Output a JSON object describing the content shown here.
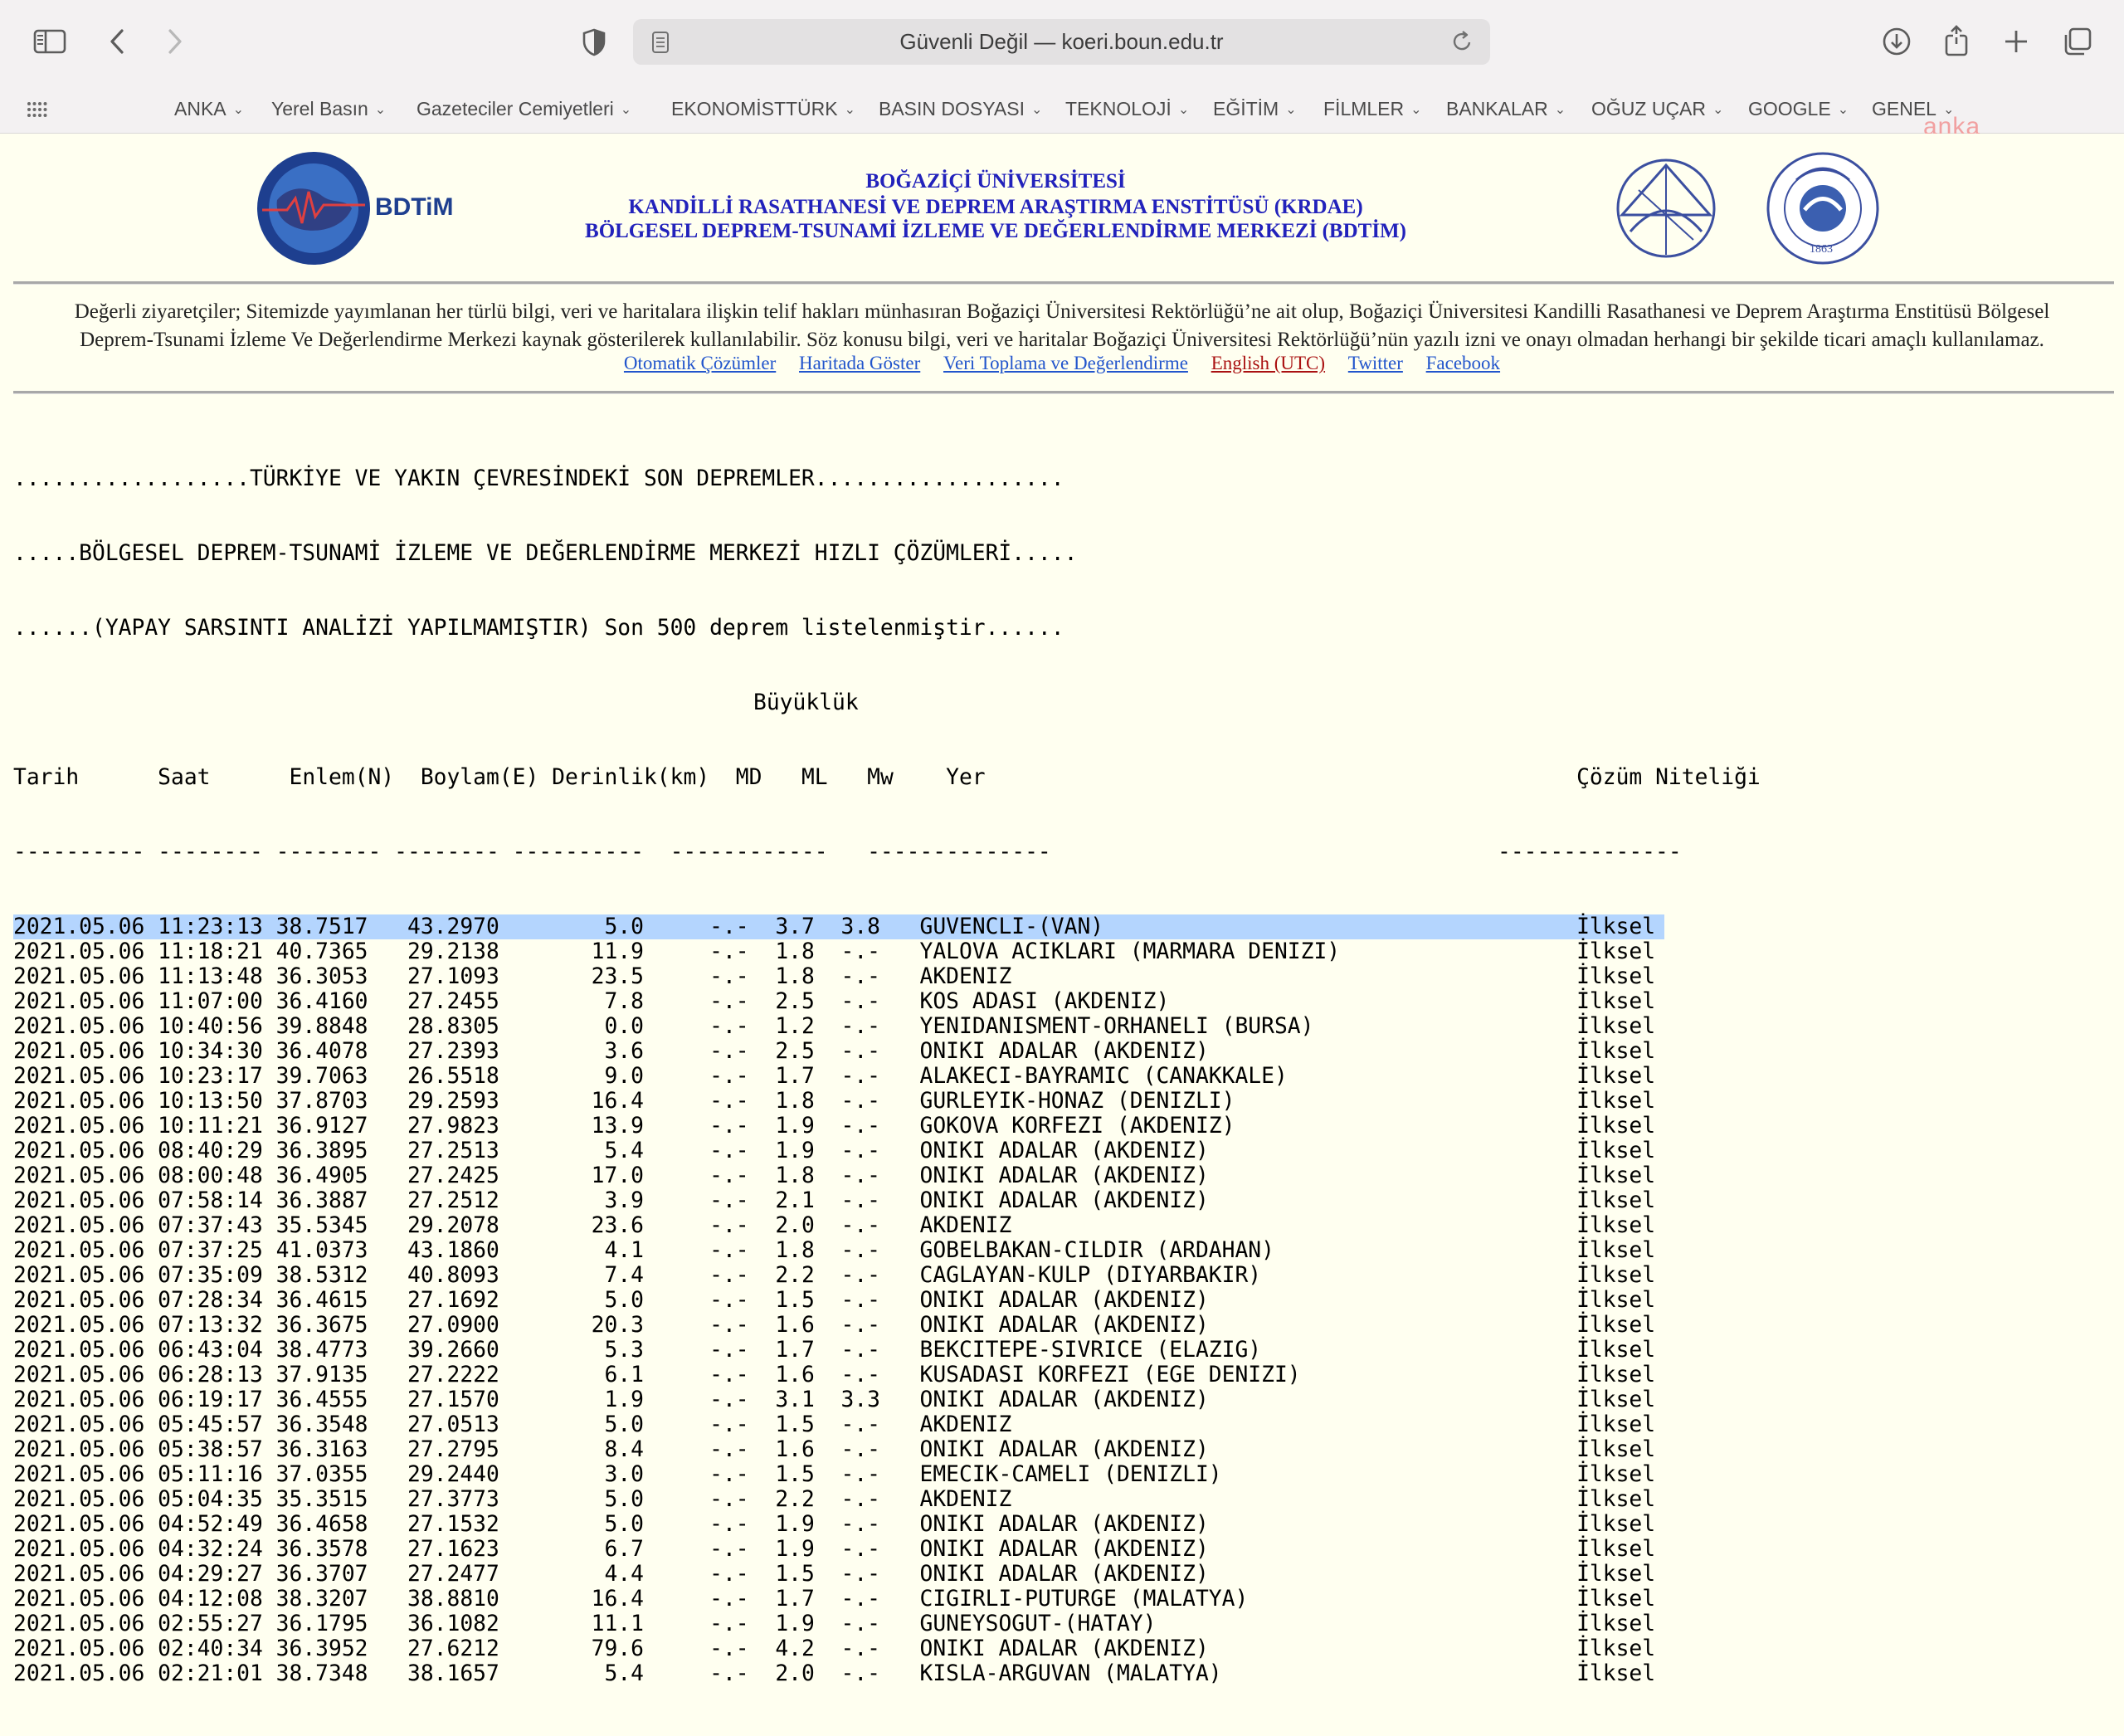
{
  "browser": {
    "url_text": "Güvenli Değil — koeri.boun.edu.tr",
    "bookmarks": [
      {
        "label": "ANKA"
      },
      {
        "label": "Yerel Basın"
      },
      {
        "label": "Gazeteciler Cemiyetleri"
      },
      {
        "label": "EKONOMİSTTÜRK"
      },
      {
        "label": "BASIN DOSYASI"
      },
      {
        "label": "TEKNOLOJİ"
      },
      {
        "label": "EĞİTİM"
      },
      {
        "label": "FİLMLER"
      },
      {
        "label": "BANKALAR"
      },
      {
        "label": "OĞUZ UÇAR"
      },
      {
        "label": "GOOGLE"
      },
      {
        "label": "GENEL"
      }
    ]
  },
  "watermark": "anka",
  "header": {
    "logo_text": "BDTiM",
    "line1": "BOĞAZİÇİ ÜNİVERSİTESİ",
    "line2": "KANDİLLİ RASATHANESİ VE DEPREM ARAŞTIRMA ENSTİTÜSÜ (KRDAE)",
    "line3": "BÖLGESEL DEPREM-TSUNAMİ İZLEME VE DEĞERLENDİRME MERKEZİ (BDTİM)",
    "seal_year": "1863"
  },
  "notice": {
    "line1": "Değerli ziyaretçiler; Sitemizde yayımlanan her türlü bilgi, veri ve haritalara ilişkin telif hakları münhasıran Boğaziçi Üniversitesi Rektörlüğü’ne ait olup, Boğaziçi Üniversitesi Kandilli Rasathanesi ve Deprem Araştırma Enstitüsü Bölgesel",
    "line2": "Deprem-Tsunami İzleme Ve Değerlendirme Merkezi kaynak gösterilerek kullanılabilir. Söz konusu bilgi, veri ve haritalar Boğaziçi Üniversitesi Rektörlüğü’nün yazılı izni ve onayı olmadan herhangi bir şekilde ticari amaçlı kullanılamaz."
  },
  "links": {
    "auto": "Otomatik Çözümler",
    "map": "Haritada Göster",
    "data": "Veri Toplama ve Değerlendirme",
    "english": "English (UTC)",
    "twitter": "Twitter",
    "facebook": "Facebook"
  },
  "listing": {
    "title1": "..................TÜRKİYE VE YAKIN ÇEVRESİNDEKİ SON DEPREMLER...................",
    "title2": ".....BÖLGESEL DEPREM-TSUNAMİ İZLEME VE DEĞERLENDİRME MERKEZİ HIZLI ÇÖZÜMLERİ.....",
    "title3": "......(YAPAY SARSINTI ANALİZİ YAPILMAMIŞTIR) Son 500 deprem listelenmiştir......",
    "magnitude_header": "Büyüklük",
    "columns": {
      "date": "Tarih",
      "time": "Saat",
      "lat": "Enlem(N)",
      "lon": "Boylam(E)",
      "depth": "Derinlik(km)",
      "md": "MD",
      "ml": "ML",
      "mw": "Mw",
      "place": "Yer",
      "quality": "Çözüm Niteliği"
    },
    "rows": [
      [
        "2021.05.06",
        "11:23:13",
        "38.7517",
        "43.2970",
        "5.0",
        "-.-",
        "3.7",
        "3.8",
        "GUVENCLI-(VAN)",
        "İlksel"
      ],
      [
        "2021.05.06",
        "11:18:21",
        "40.7365",
        "29.2138",
        "11.9",
        "-.-",
        "1.8",
        "-.-",
        "YALOVA ACIKLARI (MARMARA DENIZI)",
        "İlksel"
      ],
      [
        "2021.05.06",
        "11:13:48",
        "36.3053",
        "27.1093",
        "23.5",
        "-.-",
        "1.8",
        "-.-",
        "AKDENIZ",
        "İlksel"
      ],
      [
        "2021.05.06",
        "11:07:00",
        "36.4160",
        "27.2455",
        "7.8",
        "-.-",
        "2.5",
        "-.-",
        "KOS ADASI (AKDENIZ)",
        "İlksel"
      ],
      [
        "2021.05.06",
        "10:40:56",
        "39.8848",
        "28.8305",
        "0.0",
        "-.-",
        "1.2",
        "-.-",
        "YENIDANISMENT-ORHANELI (BURSA)",
        "İlksel"
      ],
      [
        "2021.05.06",
        "10:34:30",
        "36.4078",
        "27.2393",
        "3.6",
        "-.-",
        "2.5",
        "-.-",
        "ONIKI ADALAR (AKDENIZ)",
        "İlksel"
      ],
      [
        "2021.05.06",
        "10:23:17",
        "39.7063",
        "26.5518",
        "9.0",
        "-.-",
        "1.7",
        "-.-",
        "ALAKECI-BAYRAMIC (CANAKKALE)",
        "İlksel"
      ],
      [
        "2021.05.06",
        "10:13:50",
        "37.8703",
        "29.2593",
        "16.4",
        "-.-",
        "1.8",
        "-.-",
        "GURLEYIK-HONAZ (DENIZLI)",
        "İlksel"
      ],
      [
        "2021.05.06",
        "10:11:21",
        "36.9127",
        "27.9823",
        "13.9",
        "-.-",
        "1.9",
        "-.-",
        "GOKOVA KORFEZI (AKDENIZ)",
        "İlksel"
      ],
      [
        "2021.05.06",
        "08:40:29",
        "36.3895",
        "27.2513",
        "5.4",
        "-.-",
        "1.9",
        "-.-",
        "ONIKI ADALAR (AKDENIZ)",
        "İlksel"
      ],
      [
        "2021.05.06",
        "08:00:48",
        "36.4905",
        "27.2425",
        "17.0",
        "-.-",
        "1.8",
        "-.-",
        "ONIKI ADALAR (AKDENIZ)",
        "İlksel"
      ],
      [
        "2021.05.06",
        "07:58:14",
        "36.3887",
        "27.2512",
        "3.9",
        "-.-",
        "2.1",
        "-.-",
        "ONIKI ADALAR (AKDENIZ)",
        "İlksel"
      ],
      [
        "2021.05.06",
        "07:37:43",
        "35.5345",
        "29.2078",
        "23.6",
        "-.-",
        "2.0",
        "-.-",
        "AKDENIZ",
        "İlksel"
      ],
      [
        "2021.05.06",
        "07:37:25",
        "41.0373",
        "43.1860",
        "4.1",
        "-.-",
        "1.8",
        "-.-",
        "GOBELBAKAN-CILDIR (ARDAHAN)",
        "İlksel"
      ],
      [
        "2021.05.06",
        "07:35:09",
        "38.5312",
        "40.8093",
        "7.4",
        "-.-",
        "2.2",
        "-.-",
        "CAGLAYAN-KULP (DIYARBAKIR)",
        "İlksel"
      ],
      [
        "2021.05.06",
        "07:28:34",
        "36.4615",
        "27.1692",
        "5.0",
        "-.-",
        "1.5",
        "-.-",
        "ONIKI ADALAR (AKDENIZ)",
        "İlksel"
      ],
      [
        "2021.05.06",
        "07:13:32",
        "36.3675",
        "27.0900",
        "20.3",
        "-.-",
        "1.6",
        "-.-",
        "ONIKI ADALAR (AKDENIZ)",
        "İlksel"
      ],
      [
        "2021.05.06",
        "06:43:04",
        "38.4773",
        "39.2660",
        "5.3",
        "-.-",
        "1.7",
        "-.-",
        "BEKCITEPE-SIVRICE (ELAZIG)",
        "İlksel"
      ],
      [
        "2021.05.06",
        "06:28:13",
        "37.9135",
        "27.2222",
        "6.1",
        "-.-",
        "1.6",
        "-.-",
        "KUSADASI KORFEZI (EGE DENIZI)",
        "İlksel"
      ],
      [
        "2021.05.06",
        "06:19:17",
        "36.4555",
        "27.1570",
        "1.9",
        "-.-",
        "3.1",
        "3.3",
        "ONIKI ADALAR (AKDENIZ)",
        "İlksel"
      ],
      [
        "2021.05.06",
        "05:45:57",
        "36.3548",
        "27.0513",
        "5.0",
        "-.-",
        "1.5",
        "-.-",
        "AKDENIZ",
        "İlksel"
      ],
      [
        "2021.05.06",
        "05:38:57",
        "36.3163",
        "27.2795",
        "8.4",
        "-.-",
        "1.6",
        "-.-",
        "ONIKI ADALAR (AKDENIZ)",
        "İlksel"
      ],
      [
        "2021.05.06",
        "05:11:16",
        "37.0355",
        "29.2440",
        "3.0",
        "-.-",
        "1.5",
        "-.-",
        "EMECIK-CAMELI (DENIZLI)",
        "İlksel"
      ],
      [
        "2021.05.06",
        "05:04:35",
        "35.3515",
        "27.3773",
        "5.0",
        "-.-",
        "2.2",
        "-.-",
        "AKDENIZ",
        "İlksel"
      ],
      [
        "2021.05.06",
        "04:52:49",
        "36.4658",
        "27.1532",
        "5.0",
        "-.-",
        "1.9",
        "-.-",
        "ONIKI ADALAR (AKDENIZ)",
        "İlksel"
      ],
      [
        "2021.05.06",
        "04:32:24",
        "36.3578",
        "27.1623",
        "6.7",
        "-.-",
        "1.9",
        "-.-",
        "ONIKI ADALAR (AKDENIZ)",
        "İlksel"
      ],
      [
        "2021.05.06",
        "04:29:27",
        "36.3707",
        "27.2477",
        "4.4",
        "-.-",
        "1.5",
        "-.-",
        "ONIKI ADALAR (AKDENIZ)",
        "İlksel"
      ],
      [
        "2021.05.06",
        "04:12:08",
        "38.3207",
        "38.8810",
        "16.4",
        "-.-",
        "1.7",
        "-.-",
        "CIGIRLI-PUTURGE (MALATYA)",
        "İlksel"
      ],
      [
        "2021.05.06",
        "02:55:27",
        "36.1795",
        "36.1082",
        "11.1",
        "-.-",
        "1.9",
        "-.-",
        "GUNEYSOGUT-(HATAY)",
        "İlksel"
      ],
      [
        "2021.05.06",
        "02:40:34",
        "36.3952",
        "27.6212",
        "79.6",
        "-.-",
        "4.2",
        "-.-",
        "ONIKI ADALAR (AKDENIZ)",
        "İlksel"
      ],
      [
        "2021.05.06",
        "02:21:01",
        "38.7348",
        "38.1657",
        "5.4",
        "-.-",
        "2.0",
        "-.-",
        "KISLA-ARGUVAN (MALATYA)",
        "İlksel"
      ]
    ]
  }
}
